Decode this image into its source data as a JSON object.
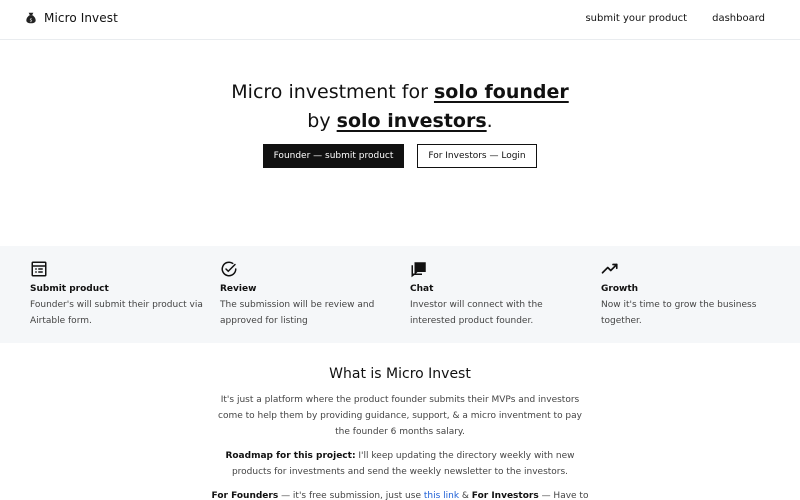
{
  "header": {
    "brand_name": "Micro Invest",
    "brand_icon": "money-bag-icon",
    "nav": [
      {
        "label": "submit your product"
      },
      {
        "label": "dashboard"
      }
    ]
  },
  "hero": {
    "line1_prefix": "Micro investment for ",
    "line1_emphasis": "solo founder",
    "line2_prefix": "by ",
    "line2_emphasis": "solo investors",
    "line2_suffix": ".",
    "primary_button": "Founder — submit product",
    "secondary_button": "For Investors — Login"
  },
  "features": [
    {
      "icon": "form-icon",
      "title": "Submit product",
      "description": "Founder's will submit their product via Airtable form."
    },
    {
      "icon": "check-circle-icon",
      "title": "Review",
      "description": "The submission will be review and approved for listing"
    },
    {
      "icon": "chat-icon",
      "title": "Chat",
      "description": "Investor will connect with the interested product founder."
    },
    {
      "icon": "trending-up-icon",
      "title": "Growth",
      "description": "Now it's time to grow the business together."
    }
  ],
  "about": {
    "title": "What is Micro Invest",
    "intro": "It's just a platform where the product founder submits their MVPs and investors come to help them by providing guidance, support, & a micro inventment to pay the founder 6 months salary.",
    "roadmap_label": "Roadmap for this project:",
    "roadmap_text": " I'll keep updating the directory weekly with new products for investments and send the weekly newsletter to the investors.",
    "founders_label": "For Founders",
    "founders_text": " — it's free submission, just use ",
    "founders_link": "this link",
    "amp": " & ",
    "investors_label": "For Investors",
    "investors_text": " — Have to pay"
  },
  "colors": {
    "primary": "#111111",
    "band_background": "#f5f7f9",
    "link": "#1d5fd6"
  }
}
